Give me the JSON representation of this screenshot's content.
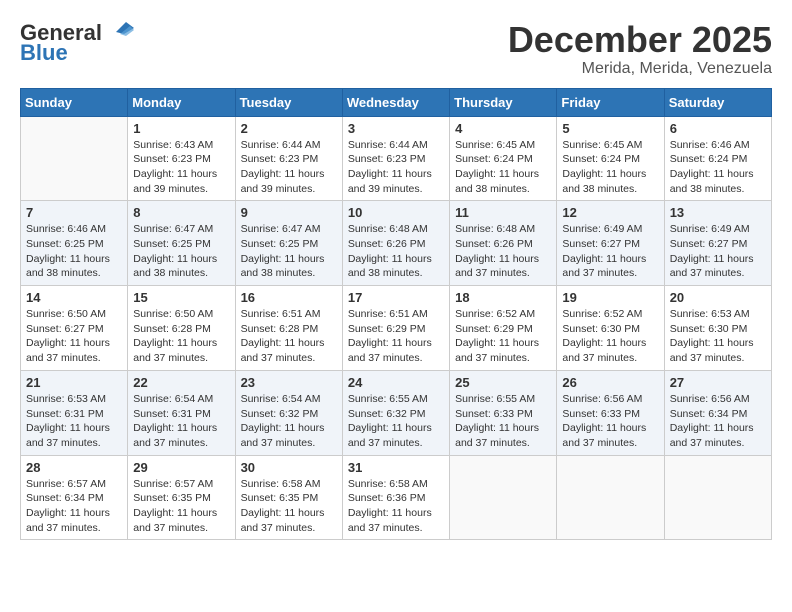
{
  "header": {
    "logo_general": "General",
    "logo_blue": "Blue",
    "month_title": "December 2025",
    "location": "Merida, Merida, Venezuela"
  },
  "calendar": {
    "days_of_week": [
      "Sunday",
      "Monday",
      "Tuesday",
      "Wednesday",
      "Thursday",
      "Friday",
      "Saturday"
    ],
    "weeks": [
      [
        {
          "day": "",
          "info": ""
        },
        {
          "day": "1",
          "info": "Sunrise: 6:43 AM\nSunset: 6:23 PM\nDaylight: 11 hours\nand 39 minutes."
        },
        {
          "day": "2",
          "info": "Sunrise: 6:44 AM\nSunset: 6:23 PM\nDaylight: 11 hours\nand 39 minutes."
        },
        {
          "day": "3",
          "info": "Sunrise: 6:44 AM\nSunset: 6:23 PM\nDaylight: 11 hours\nand 39 minutes."
        },
        {
          "day": "4",
          "info": "Sunrise: 6:45 AM\nSunset: 6:24 PM\nDaylight: 11 hours\nand 38 minutes."
        },
        {
          "day": "5",
          "info": "Sunrise: 6:45 AM\nSunset: 6:24 PM\nDaylight: 11 hours\nand 38 minutes."
        },
        {
          "day": "6",
          "info": "Sunrise: 6:46 AM\nSunset: 6:24 PM\nDaylight: 11 hours\nand 38 minutes."
        }
      ],
      [
        {
          "day": "7",
          "info": "Sunrise: 6:46 AM\nSunset: 6:25 PM\nDaylight: 11 hours\nand 38 minutes."
        },
        {
          "day": "8",
          "info": "Sunrise: 6:47 AM\nSunset: 6:25 PM\nDaylight: 11 hours\nand 38 minutes."
        },
        {
          "day": "9",
          "info": "Sunrise: 6:47 AM\nSunset: 6:25 PM\nDaylight: 11 hours\nand 38 minutes."
        },
        {
          "day": "10",
          "info": "Sunrise: 6:48 AM\nSunset: 6:26 PM\nDaylight: 11 hours\nand 38 minutes."
        },
        {
          "day": "11",
          "info": "Sunrise: 6:48 AM\nSunset: 6:26 PM\nDaylight: 11 hours\nand 37 minutes."
        },
        {
          "day": "12",
          "info": "Sunrise: 6:49 AM\nSunset: 6:27 PM\nDaylight: 11 hours\nand 37 minutes."
        },
        {
          "day": "13",
          "info": "Sunrise: 6:49 AM\nSunset: 6:27 PM\nDaylight: 11 hours\nand 37 minutes."
        }
      ],
      [
        {
          "day": "14",
          "info": "Sunrise: 6:50 AM\nSunset: 6:27 PM\nDaylight: 11 hours\nand 37 minutes."
        },
        {
          "day": "15",
          "info": "Sunrise: 6:50 AM\nSunset: 6:28 PM\nDaylight: 11 hours\nand 37 minutes."
        },
        {
          "day": "16",
          "info": "Sunrise: 6:51 AM\nSunset: 6:28 PM\nDaylight: 11 hours\nand 37 minutes."
        },
        {
          "day": "17",
          "info": "Sunrise: 6:51 AM\nSunset: 6:29 PM\nDaylight: 11 hours\nand 37 minutes."
        },
        {
          "day": "18",
          "info": "Sunrise: 6:52 AM\nSunset: 6:29 PM\nDaylight: 11 hours\nand 37 minutes."
        },
        {
          "day": "19",
          "info": "Sunrise: 6:52 AM\nSunset: 6:30 PM\nDaylight: 11 hours\nand 37 minutes."
        },
        {
          "day": "20",
          "info": "Sunrise: 6:53 AM\nSunset: 6:30 PM\nDaylight: 11 hours\nand 37 minutes."
        }
      ],
      [
        {
          "day": "21",
          "info": "Sunrise: 6:53 AM\nSunset: 6:31 PM\nDaylight: 11 hours\nand 37 minutes."
        },
        {
          "day": "22",
          "info": "Sunrise: 6:54 AM\nSunset: 6:31 PM\nDaylight: 11 hours\nand 37 minutes."
        },
        {
          "day": "23",
          "info": "Sunrise: 6:54 AM\nSunset: 6:32 PM\nDaylight: 11 hours\nand 37 minutes."
        },
        {
          "day": "24",
          "info": "Sunrise: 6:55 AM\nSunset: 6:32 PM\nDaylight: 11 hours\nand 37 minutes."
        },
        {
          "day": "25",
          "info": "Sunrise: 6:55 AM\nSunset: 6:33 PM\nDaylight: 11 hours\nand 37 minutes."
        },
        {
          "day": "26",
          "info": "Sunrise: 6:56 AM\nSunset: 6:33 PM\nDaylight: 11 hours\nand 37 minutes."
        },
        {
          "day": "27",
          "info": "Sunrise: 6:56 AM\nSunset: 6:34 PM\nDaylight: 11 hours\nand 37 minutes."
        }
      ],
      [
        {
          "day": "28",
          "info": "Sunrise: 6:57 AM\nSunset: 6:34 PM\nDaylight: 11 hours\nand 37 minutes."
        },
        {
          "day": "29",
          "info": "Sunrise: 6:57 AM\nSunset: 6:35 PM\nDaylight: 11 hours\nand 37 minutes."
        },
        {
          "day": "30",
          "info": "Sunrise: 6:58 AM\nSunset: 6:35 PM\nDaylight: 11 hours\nand 37 minutes."
        },
        {
          "day": "31",
          "info": "Sunrise: 6:58 AM\nSunset: 6:36 PM\nDaylight: 11 hours\nand 37 minutes."
        },
        {
          "day": "",
          "info": ""
        },
        {
          "day": "",
          "info": ""
        },
        {
          "day": "",
          "info": ""
        }
      ]
    ]
  }
}
